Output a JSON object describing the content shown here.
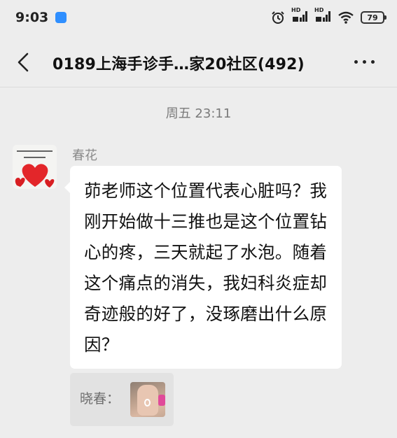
{
  "status_bar": {
    "time": "9:03",
    "signal_label_1": "HD",
    "signal_label_2": "HD",
    "battery": "79"
  },
  "header": {
    "title": "0189上海手诊手…家20社区(492)"
  },
  "conversation": {
    "timestamp": "周五 23:11",
    "message": {
      "sender": "春花",
      "text": "茆老师这个位置代表心脏吗？我刚开始做十三推也是这个位置钻心的疼，三天就起了水泡。随着这个痛点的消失，我妇科炎症却奇迹般的好了，没琢磨出什么原因？",
      "quote_label": "晓春："
    }
  },
  "colors": {
    "background": "#ededed",
    "bubble": "#ffffff",
    "heart_red": "#e3262a"
  }
}
